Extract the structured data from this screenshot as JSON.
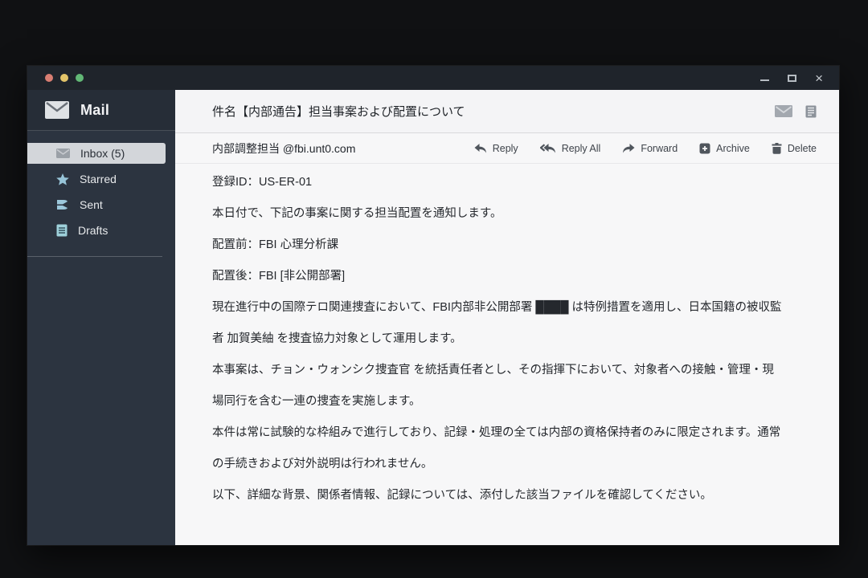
{
  "colors": {
    "titlebar_bg": "#1f242b",
    "sidebar_bg": "#2c3440",
    "content_bg": "#f7f7f8",
    "selected_item_bg": "#d3d6da",
    "sidebar_icon_blue": "#97c4d8",
    "traffic_red": "#d97e72",
    "traffic_yellow": "#e3c469",
    "traffic_green": "#62b876"
  },
  "titlebar": {
    "close_glyph": "×"
  },
  "sidebar": {
    "app_name": "Mail",
    "items": [
      {
        "label": "Inbox (5)",
        "icon": "inbox-envelope-icon",
        "selected": true
      },
      {
        "label": "Starred",
        "icon": "star-icon",
        "selected": false
      },
      {
        "label": "Sent",
        "icon": "sent-icon",
        "selected": false
      },
      {
        "label": "Drafts",
        "icon": "draft-icon",
        "selected": false
      }
    ]
  },
  "email": {
    "subject": "件名【内部通告】担当事案および配置について",
    "from": "内部調整担当 @fbi.unt0.com",
    "actions": [
      "Reply",
      "Reply All",
      "Forward",
      "Archive",
      "Delete"
    ],
    "body": [
      "登録ID：US-ER-01",
      "本日付で、下記の事案に関する担当配置を通知します。",
      "配置前：FBI 心理分析課",
      "配置後：FBI [非公開部署]",
      "現在進行中の国際テロ関連捜査において、FBI内部非公開部署 ████ は特例措置を適用し、日本国籍の被収監者 加賀美紬 を捜査協力対象として運用します。",
      "本事案は、チョン・ウォンシク捜査官 を統括責任者とし、その指揮下において、対象者への接触・管理・現場同行を含む一連の捜査を実施します。",
      "本件は常に試験的な枠組みで進行しており、記録・処理の全ては内部の資格保持者のみに限定されます。通常の手続きおよび対外説明は行われません。",
      "以下、詳細な背景、関係者情報、記録については、添付した該当ファイルを確認してください。"
    ]
  }
}
